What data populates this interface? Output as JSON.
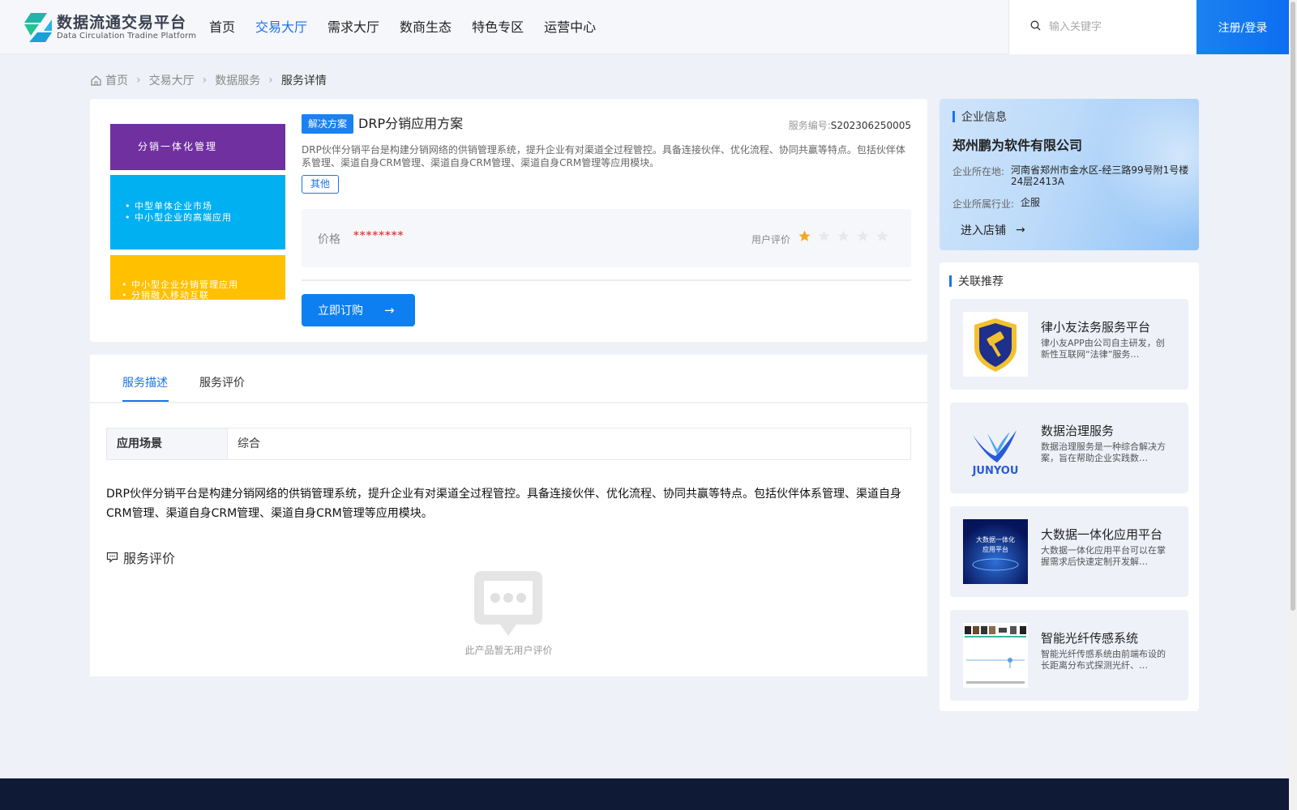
{
  "header": {
    "logo_cn": "数据流通交易平台",
    "logo_en": "Data Circulation Tradine Platform",
    "nav": [
      "首页",
      "交易大厅",
      "需求大厅",
      "数商生态",
      "特色专区",
      "运营中心"
    ],
    "active_nav": "交易大厅",
    "search_placeholder": "输入关键字",
    "login_label": "注册/登录"
  },
  "breadcrumb": [
    "首页",
    "交易大厅",
    "数据服务",
    "服务详情"
  ],
  "product": {
    "image_text": {
      "band1": "分销一体化管理",
      "band2_line1": "• 中型单体企业市场",
      "band2_line2": "• 中小型企业的高端应用",
      "band3_line1": "• 中小型企业分销管理应用",
      "band3_line2": "• 分销融入移动互联"
    },
    "tag": "解决方案",
    "title": "DRP分销应用方案",
    "service_no_label": "服务编号:",
    "service_no": "S202306250005",
    "description": "DRP伙伴分销平台是构建分销网络的供销管理系统，提升企业有对渠道全过程管控。具备连接伙伴、优化流程、协同共赢等特点。包括伙伴体系管理、渠道自身CRM管理、渠道自身CRM管理、渠道自身CRM管理等应用模块。",
    "category": "其他",
    "price_label": "价格",
    "price_value": "********",
    "rating_label": "用户评价",
    "rating": 1,
    "rating_max": 5,
    "subscribe_label": "立即订购"
  },
  "detail": {
    "tabs": [
      "服务描述",
      "服务评价"
    ],
    "active_tab": "服务描述",
    "scene_key": "应用场景",
    "scene_value": "综合",
    "text": "DRP伙伴分销平台是构建分销网络的供销管理系统，提升企业有对渠道全过程管控。具备连接伙伴、优化流程、协同共赢等特点。包括伙伴体系管理、渠道自身CRM管理、渠道自身CRM管理、渠道自身CRM管理等应用模块。",
    "review_title": "服务评价",
    "empty_text": "此产品暂无用户评价"
  },
  "company": {
    "section_title": "企业信息",
    "name": "郑州鹏为软件有限公司",
    "location_label": "企业所在地:",
    "location": "河南省郑州市金水区-经三路99号附1号楼24层2413A",
    "industry_label": "企业所属行业:",
    "industry": "企服",
    "enter_label": "进入店铺"
  },
  "recommendations": {
    "section_title": "关联推荐",
    "items": [
      {
        "title": "律小友法务服务平台",
        "desc": "律小友APP由公司自主研发，创新性互联网“法律”服务…",
        "icon": "shield-gavel-logo"
      },
      {
        "title": "数据治理服务",
        "desc": "数据治理服务是一种综合解决方案，旨在帮助企业实践数…",
        "icon": "junyou-logo",
        "logo_text": "JUNYOU"
      },
      {
        "title": "大数据一体化应用平台",
        "desc": "大数据一体化应用平台可以在掌握需求后快速定制开发解…",
        "icon": "bigdata-poster",
        "thumb_text_1": "大数据一体化",
        "thumb_text_2": "应用平台"
      },
      {
        "title": "智能光纤传感系统",
        "desc": "智能光纤传感系统由前端布设的长距离分布式探测光纤、…",
        "icon": "fiber-screenshot"
      }
    ]
  },
  "colors": {
    "primary": "#1a73e8",
    "button": "#0d7ff0",
    "price": "#e64545",
    "star_active": "#f5a623",
    "footer": "#0f1a36"
  }
}
